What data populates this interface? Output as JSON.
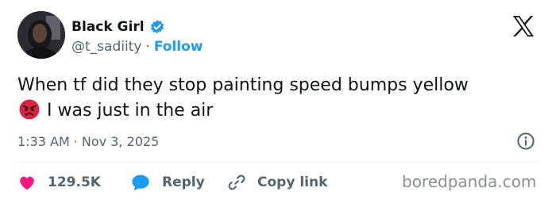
{
  "user": {
    "display_name": "Black Girl",
    "handle": "@t_sadiity",
    "separator": "·",
    "follow_label": "Follow"
  },
  "tweet": {
    "text_part1": "When tf did they stop painting speed bumps yellow",
    "emoji": "angry-face-emoji",
    "text_part2": "I was just in the air",
    "time": "1:33 AM",
    "separator": "·",
    "date": "Nov 3, 2025"
  },
  "actions": {
    "like_count": "129.5K",
    "reply_label": "Reply",
    "copy_link_label": "Copy link"
  },
  "watermark": "boredpanda.com",
  "colors": {
    "accent": "#1d9bf0",
    "like": "#f91880",
    "text": "#0f1419",
    "muted": "#536471"
  }
}
